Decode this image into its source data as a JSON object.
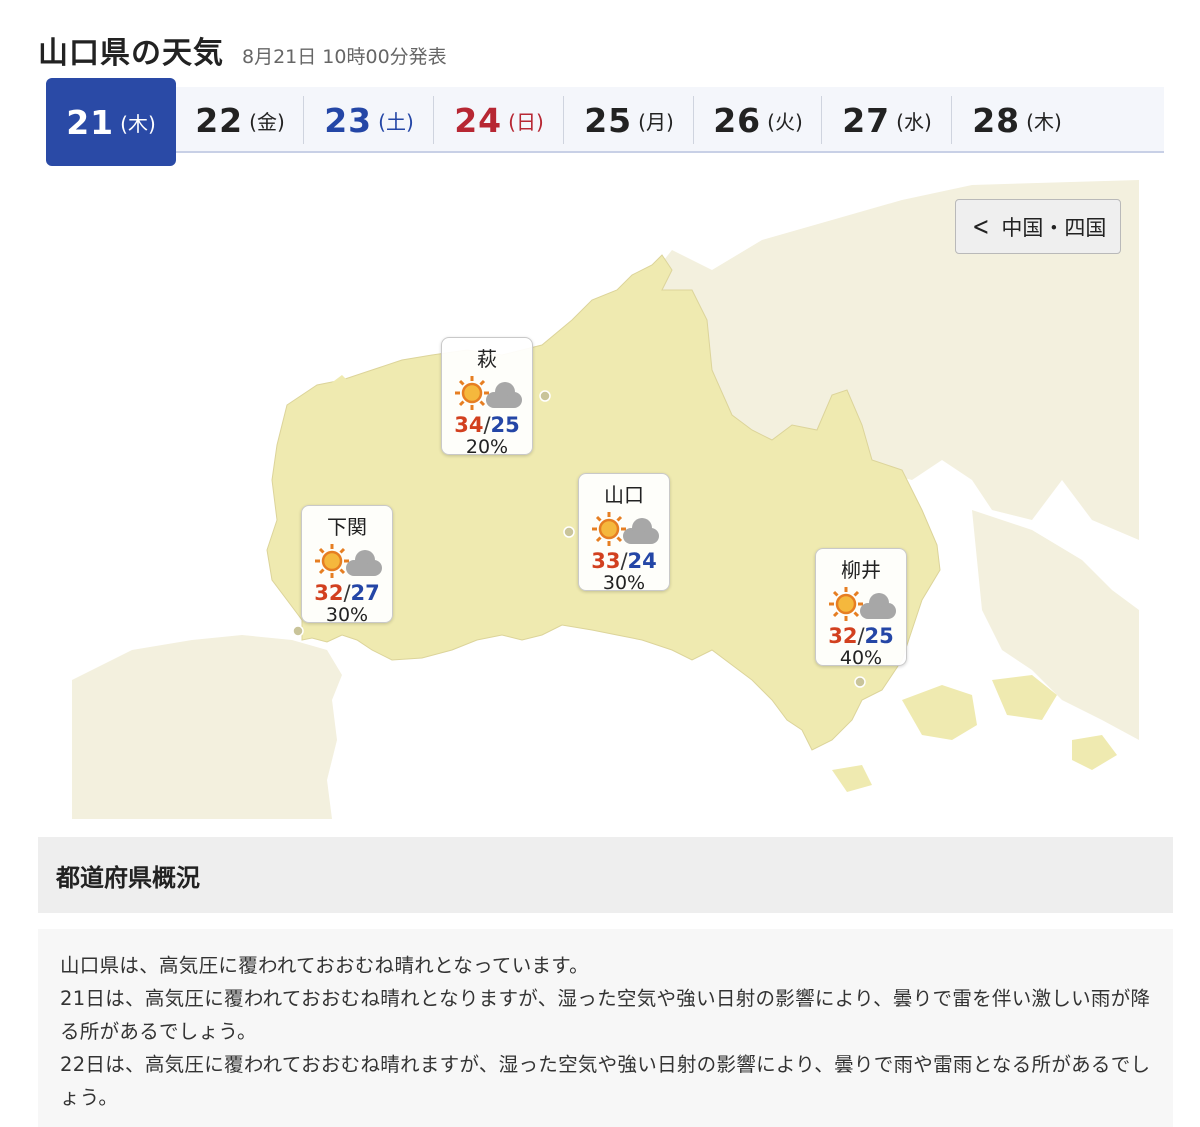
{
  "header": {
    "title": "山口県の天気",
    "issued": "8月21日 10時00分発表"
  },
  "tabs": [
    {
      "num": "21",
      "dow": "(木)",
      "color": "black",
      "active": true
    },
    {
      "num": "22",
      "dow": "(金)",
      "color": "black",
      "active": false
    },
    {
      "num": "23",
      "dow": "(土)",
      "color": "blue",
      "active": false
    },
    {
      "num": "24",
      "dow": "(日)",
      "color": "red",
      "active": false
    },
    {
      "num": "25",
      "dow": "(月)",
      "color": "black",
      "active": false
    },
    {
      "num": "26",
      "dow": "(火)",
      "color": "black",
      "active": false
    },
    {
      "num": "27",
      "dow": "(水)",
      "color": "black",
      "active": false
    },
    {
      "num": "28",
      "dow": "(木)",
      "color": "black",
      "active": false
    }
  ],
  "region_button": {
    "label": "中国・四国",
    "icon": "chevron-left-icon"
  },
  "cities": [
    {
      "name": "萩",
      "weather": "sunny-then-cloudy",
      "high": "34",
      "low": "25",
      "pop": "20%"
    },
    {
      "name": "山口",
      "weather": "sunny-then-cloudy",
      "high": "33",
      "low": "24",
      "pop": "30%"
    },
    {
      "name": "下関",
      "weather": "sunny-then-cloudy",
      "high": "32",
      "low": "27",
      "pop": "30%"
    },
    {
      "name": "柳井",
      "weather": "sunny-then-cloudy",
      "high": "32",
      "low": "25",
      "pop": "40%"
    }
  ],
  "section": {
    "title": "都道府県概況"
  },
  "overview": [
    "山口県は、高気圧に覆われておおむね晴れとなっています。",
    "21日は、高気圧に覆われておおむね晴れとなりますが、湿った空気や強い日射の影響により、曇りで雷を伴い激しい雨が降る所があるでしょう。",
    "22日は、高気圧に覆われておおむね晴れますが、湿った空気や強い日射の影響により、曇りで雨や雷雨となる所があるでしょう。"
  ],
  "colors": {
    "accent": "#2a4aa6",
    "sunday": "#b72733",
    "saturday": "#2446a6",
    "map_land": "#efeab0",
    "map_other": "#f3f0de",
    "temp_high": "#d2401f",
    "temp_low": "#2446a6"
  }
}
